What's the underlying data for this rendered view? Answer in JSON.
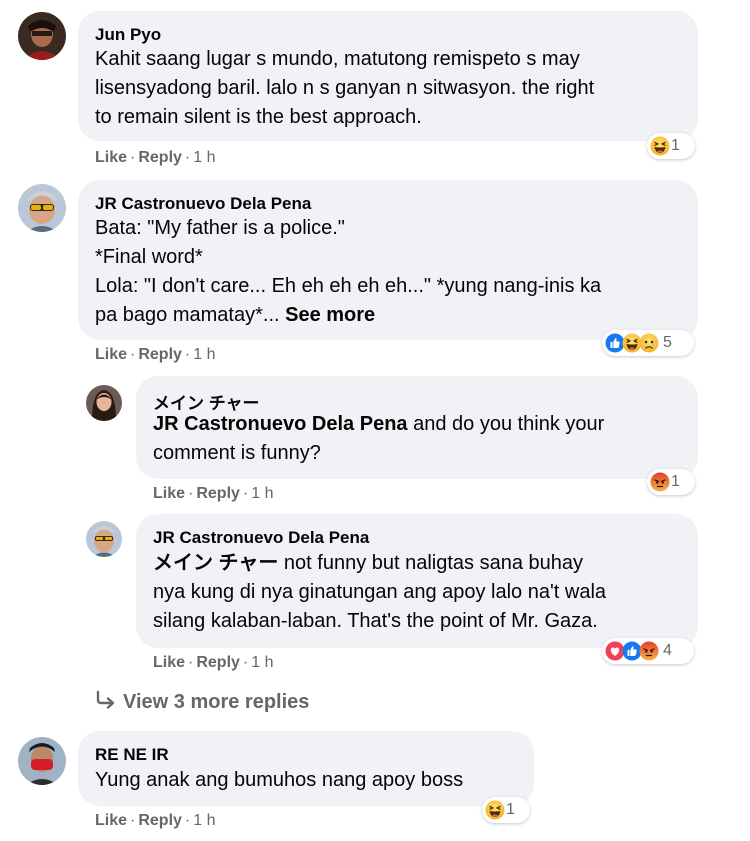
{
  "comments": [
    {
      "author": "Jun Pyo",
      "lines": [
        "Kahit saang lugar s mundo, matutong remispeto s may",
        "lisensyadong baril. lalo n s ganyan n sitwasyon. the right",
        "to remain silent is the best approach."
      ],
      "like": "Like",
      "reply": "Reply",
      "time": "1 h",
      "reaction_count": "1"
    },
    {
      "author": "JR Castronuevo Dela Pena",
      "lines": [
        "Bata: \"My father is a police.\"",
        "*Final word*",
        "Lola: \"I don't care... Eh eh eh eh eh...\" *yung nang-inis ka",
        "pa bago mamatay*..."
      ],
      "see_more": "See more",
      "like": "Like",
      "reply": "Reply",
      "time": "1 h",
      "reaction_count": "5"
    },
    {
      "author": "メイン チャー",
      "mention": "JR Castronuevo Dela Pena",
      "line1_rest": " and do you think your",
      "lines": [
        "comment is funny?"
      ],
      "like": "Like",
      "reply": "Reply",
      "time": "1 h",
      "reaction_count": "1"
    },
    {
      "author": "JR Castronuevo Dela Pena",
      "mention": "メイン チャー",
      "line1_rest": " not funny but naligtas sana buhay",
      "lines": [
        "nya kung di nya ginatungan ang apoy lalo na't wala",
        "silang kalaban-laban. That's the point of Mr. Gaza."
      ],
      "like": "Like",
      "reply": "Reply",
      "time": "1 h",
      "reaction_count": "4"
    },
    {
      "author": "RE NE IR",
      "lines": [
        "Yung anak ang bumuhos nang apoy boss"
      ],
      "like": "Like",
      "reply": "Reply",
      "time": "1 h",
      "reaction_count": "1"
    }
  ],
  "view_more_replies": "View 3 more replies",
  "separator": "·",
  "icons": {
    "haha": "haha-reaction-icon",
    "like": "like-reaction-icon",
    "sad": "sad-reaction-icon",
    "angry": "angry-reaction-icon",
    "love": "love-reaction-icon",
    "reply_arrow": "reply-arrow-icon"
  },
  "colors": {
    "bubble": "#f0f2f5",
    "meta": "#65676b",
    "text": "#050505",
    "like_blue": "#1877f2",
    "love_red": "#f33e58",
    "haha_yellow": "#f7b125",
    "angry_orange": "#e9710f"
  }
}
